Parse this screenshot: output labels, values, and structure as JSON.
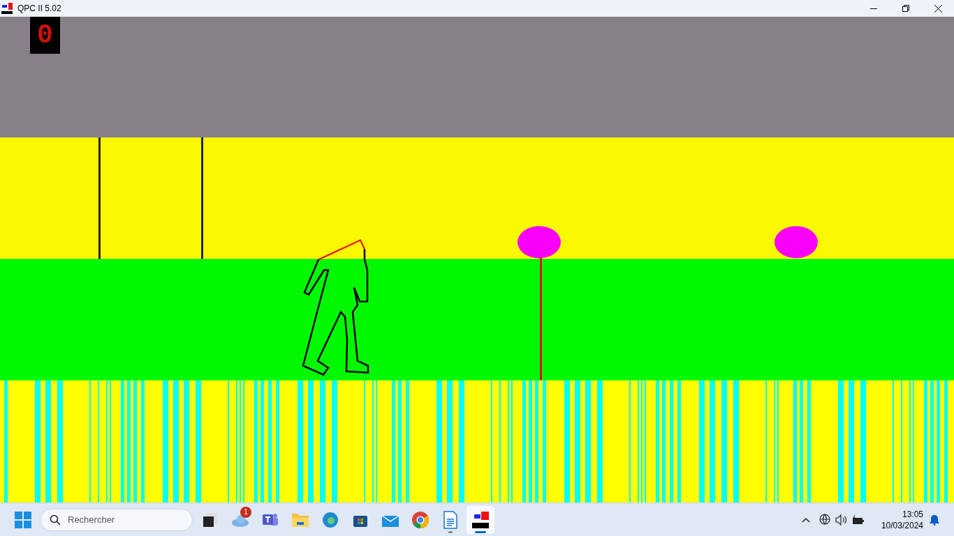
{
  "window": {
    "title": "QPC II 5.02"
  },
  "game": {
    "score": "0"
  },
  "taskbar": {
    "search": {
      "placeholder": "Rechercher"
    },
    "apps": [
      {
        "kind": "taskview",
        "running": false,
        "active": false
      },
      {
        "kind": "weather",
        "running": false,
        "active": false,
        "badge": "1"
      },
      {
        "kind": "teams",
        "running": false,
        "active": false
      },
      {
        "kind": "folder",
        "running": false,
        "active": false
      },
      {
        "kind": "edge",
        "running": false,
        "active": false
      },
      {
        "kind": "store",
        "running": false,
        "active": false
      },
      {
        "kind": "mail",
        "running": false,
        "active": false
      },
      {
        "kind": "chrome",
        "running": false,
        "active": false
      },
      {
        "kind": "writer",
        "running": true,
        "active": false
      },
      {
        "kind": "qpc",
        "running": true,
        "active": true
      }
    ],
    "time": "13:05",
    "date": "10/03/2024"
  }
}
